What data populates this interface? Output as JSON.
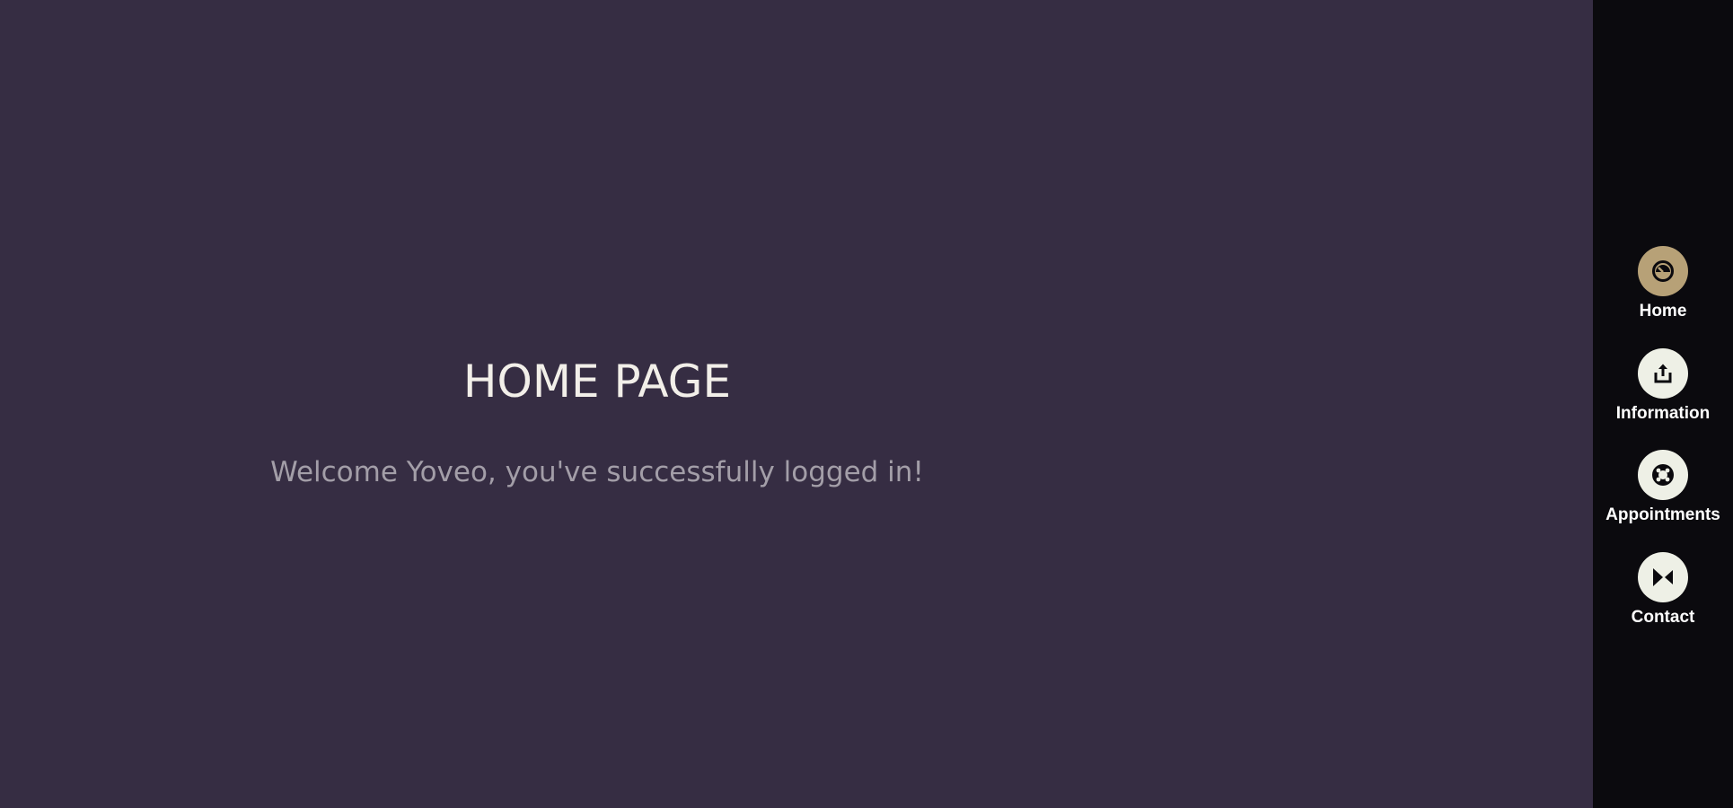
{
  "main": {
    "title": "HOME PAGE",
    "welcome_message": "Welcome Yoveo, you've successfully logged in!"
  },
  "sidebar": {
    "items": [
      {
        "label": "Home",
        "icon": "gauge-icon",
        "active": true
      },
      {
        "label": "Information",
        "icon": "share-upload-icon",
        "active": false
      },
      {
        "label": "Appointments",
        "icon": "lifebuoy-icon",
        "active": false
      },
      {
        "label": "Contact",
        "icon": "bowtie-icon",
        "active": false
      }
    ]
  },
  "colors": {
    "background": "#362d43",
    "sidebar_background": "#0b0a0e",
    "active_icon_bg": "#b7a177",
    "icon_bg": "#eef0e6",
    "title_text": "#f2efe9",
    "welcome_text": "#a39ea8"
  }
}
